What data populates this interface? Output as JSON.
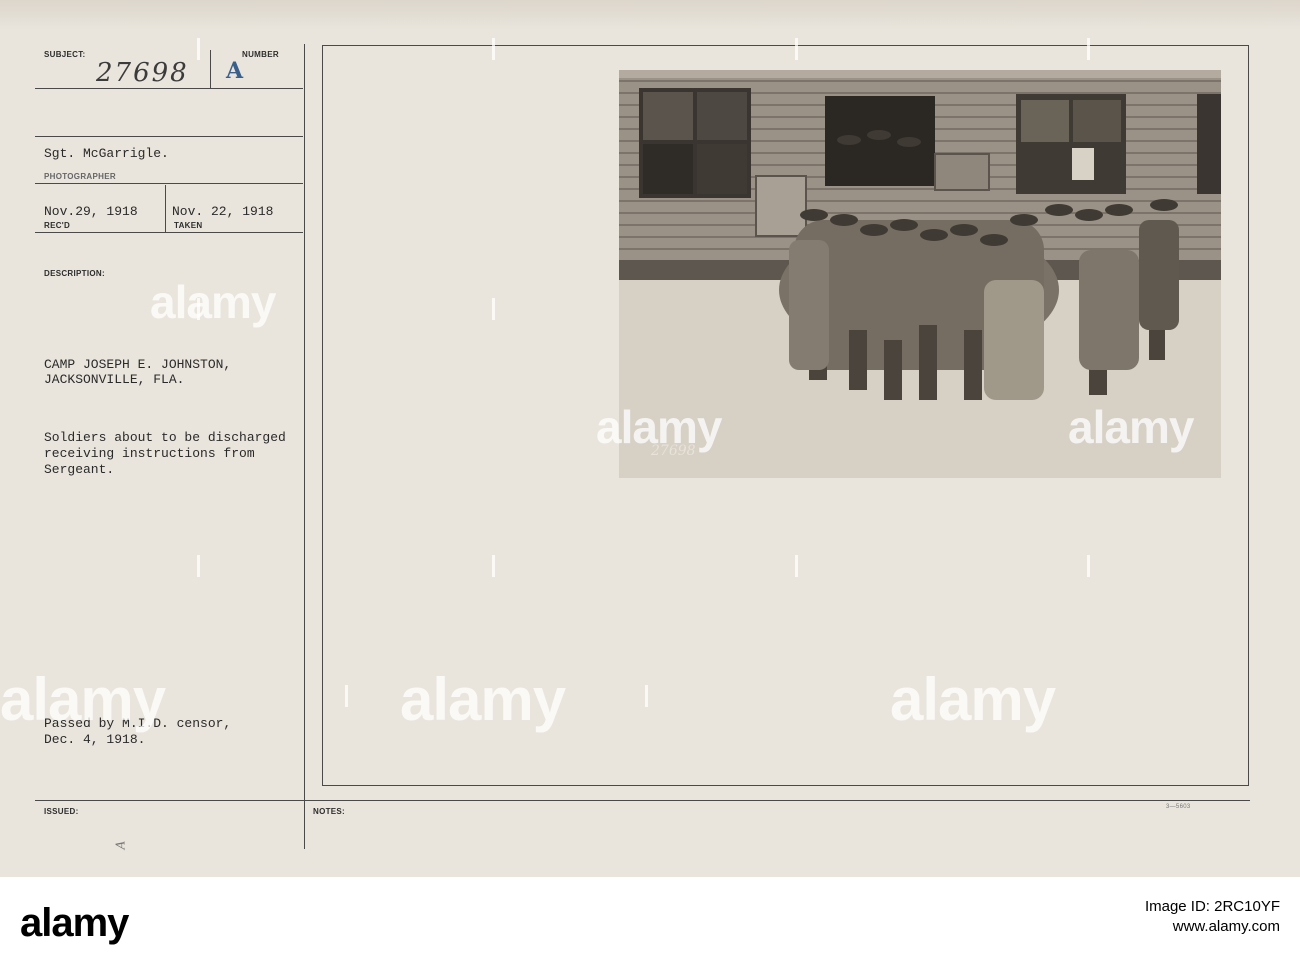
{
  "card": {
    "subject_label": "SUBJECT:",
    "subject_value": "27698",
    "number_label": "NUMBER",
    "number_value": "A",
    "photographer_name": "Sgt. McGarrigle.",
    "photographer_label": "PHOTOGRAPHER",
    "recd_date": "Nov.29, 1918",
    "recd_label": "REC'D",
    "taken_date": "Nov. 22, 1918",
    "taken_label": "TAKEN",
    "description_label": "DESCRIPTION:",
    "location_line1": "CAMP JOSEPH E. JOHNSTON,",
    "location_line2": "JACKSONVILLE, FLA.",
    "caption_line1": "Soldiers about to be discharged",
    "caption_line2": "receiving instructions from",
    "caption_line3": "Sergeant.",
    "censor_line1": "Passed by M.I.D. censor,",
    "censor_line2": "Dec. 4, 1918.",
    "issued_label": "ISSUED:",
    "notes_label": "NOTES:",
    "form_code": "3—5603",
    "issued_mark": "A"
  },
  "photo": {
    "negative_number": "27698"
  },
  "watermark": {
    "text": "alamy"
  },
  "footer": {
    "brand": "alamy",
    "image_id": "Image ID: 2RC10YF",
    "site": "www.alamy.com"
  }
}
